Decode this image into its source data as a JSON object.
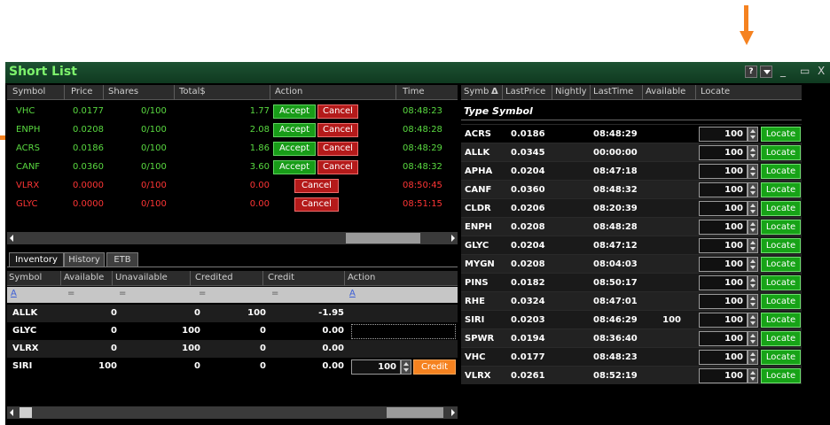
{
  "colors": {
    "accent_orange": "#f58220",
    "green_text": "#59d940",
    "red_text": "#ff3535",
    "title_green": "#7df26c"
  },
  "window": {
    "title": "Short List",
    "help_label": "?",
    "menu_icon": "chevron-down-icon",
    "minimize_icon": "minimize-icon",
    "maximize_icon": "maximize-icon",
    "close_icon": "close-icon"
  },
  "order_table": {
    "headers": {
      "symbol": "Symbol",
      "price": "Price",
      "shares": "Shares",
      "total": "Total$",
      "action": "Action",
      "time": "Time"
    },
    "rows": [
      {
        "symbol": "VHC",
        "price": "0.0177",
        "shares": "0/100",
        "total": "1.77",
        "accept": "Accept",
        "cancel": "Cancel",
        "time": "08:48:23",
        "status": "green"
      },
      {
        "symbol": "ENPH",
        "price": "0.0208",
        "shares": "0/100",
        "total": "2.08",
        "accept": "Accept",
        "cancel": "Cancel",
        "time": "08:48:28",
        "status": "green"
      },
      {
        "symbol": "ACRS",
        "price": "0.0186",
        "shares": "0/100",
        "total": "1.86",
        "accept": "Accept",
        "cancel": "Cancel",
        "time": "08:48:29",
        "status": "green"
      },
      {
        "symbol": "CANF",
        "price": "0.0360",
        "shares": "0/100",
        "total": "3.60",
        "accept": "Accept",
        "cancel": "Cancel",
        "time": "08:48:32",
        "status": "green"
      },
      {
        "symbol": "VLRX",
        "price": "0.0000",
        "shares": "0/100",
        "total": "0.00",
        "accept": "",
        "cancel": "Cancel",
        "time": "08:50:45",
        "status": "red"
      },
      {
        "symbol": "GLYC",
        "price": "0.0000",
        "shares": "0/100",
        "total": "0.00",
        "accept": "",
        "cancel": "Cancel",
        "time": "08:51:15",
        "status": "red"
      }
    ]
  },
  "tabs": [
    {
      "label": "Inventory",
      "active": true
    },
    {
      "label": "History",
      "active": false
    },
    {
      "label": "ETB",
      "active": false
    }
  ],
  "inventory": {
    "headers": {
      "symbol": "Symbol",
      "available": "Available",
      "unavailable": "Unavailable",
      "credited": "Credited",
      "credit": "Credit",
      "action": "Action"
    },
    "filter": {
      "symbol": "A",
      "available": "=",
      "unavailable": "=",
      "credited": "=",
      "credit": "=",
      "action": "A"
    },
    "rows": [
      {
        "symbol": "ALLK",
        "available": "0",
        "unavailable": "0",
        "credited": "100",
        "credit": "-1.95",
        "qty": "",
        "action_label": ""
      },
      {
        "symbol": "GLYC",
        "available": "0",
        "unavailable": "100",
        "credited": "0",
        "credit": "0.00",
        "qty": "",
        "action_label": ""
      },
      {
        "symbol": "VLRX",
        "available": "0",
        "unavailable": "100",
        "credited": "0",
        "credit": "0.00",
        "qty": "",
        "action_label": ""
      },
      {
        "symbol": "SIRI",
        "available": "100",
        "unavailable": "0",
        "credited": "0",
        "credit": "0.00",
        "qty": "100",
        "action_label": "Credit"
      }
    ]
  },
  "symbols_table": {
    "headers": {
      "symb": "Symb",
      "sort_icon": "Δ",
      "last_price": "LastPrice",
      "nightly": "Nightly",
      "last_time": "LastTime",
      "available": "Available",
      "locate": "Locate"
    },
    "type_placeholder": "Type Symbol",
    "rows": [
      {
        "symbol": "ACRS",
        "last_price": "0.0186",
        "last_time": "08:48:29",
        "available": "",
        "qty": "100",
        "locate": "Locate"
      },
      {
        "symbol": "ALLK",
        "last_price": "0.0345",
        "last_time": "00:00:00",
        "available": "",
        "qty": "100",
        "locate": "Locate"
      },
      {
        "symbol": "APHA",
        "last_price": "0.0204",
        "last_time": "08:47:18",
        "available": "",
        "qty": "100",
        "locate": "Locate"
      },
      {
        "symbol": "CANF",
        "last_price": "0.0360",
        "last_time": "08:48:32",
        "available": "",
        "qty": "100",
        "locate": "Locate"
      },
      {
        "symbol": "CLDR",
        "last_price": "0.0206",
        "last_time": "08:20:39",
        "available": "",
        "qty": "100",
        "locate": "Locate"
      },
      {
        "symbol": "ENPH",
        "last_price": "0.0208",
        "last_time": "08:48:28",
        "available": "",
        "qty": "100",
        "locate": "Locate"
      },
      {
        "symbol": "GLYC",
        "last_price": "0.0204",
        "last_time": "08:47:12",
        "available": "",
        "qty": "100",
        "locate": "Locate"
      },
      {
        "symbol": "MYGN",
        "last_price": "0.0208",
        "last_time": "08:04:03",
        "available": "",
        "qty": "100",
        "locate": "Locate"
      },
      {
        "symbol": "PINS",
        "last_price": "0.0182",
        "last_time": "08:50:17",
        "available": "",
        "qty": "100",
        "locate": "Locate"
      },
      {
        "symbol": "RHE",
        "last_price": "0.0324",
        "last_time": "08:47:01",
        "available": "",
        "qty": "100",
        "locate": "Locate"
      },
      {
        "symbol": "SIRI",
        "last_price": "0.0203",
        "last_time": "08:46:29",
        "available": "100",
        "qty": "100",
        "locate": "Locate"
      },
      {
        "symbol": "SPWR",
        "last_price": "0.0194",
        "last_time": "08:36:40",
        "available": "",
        "qty": "100",
        "locate": "Locate"
      },
      {
        "symbol": "VHC",
        "last_price": "0.0177",
        "last_time": "08:48:23",
        "available": "",
        "qty": "100",
        "locate": "Locate"
      },
      {
        "symbol": "VLRX",
        "last_price": "0.0261",
        "last_time": "08:52:19",
        "available": "",
        "qty": "100",
        "locate": "Locate"
      }
    ]
  }
}
